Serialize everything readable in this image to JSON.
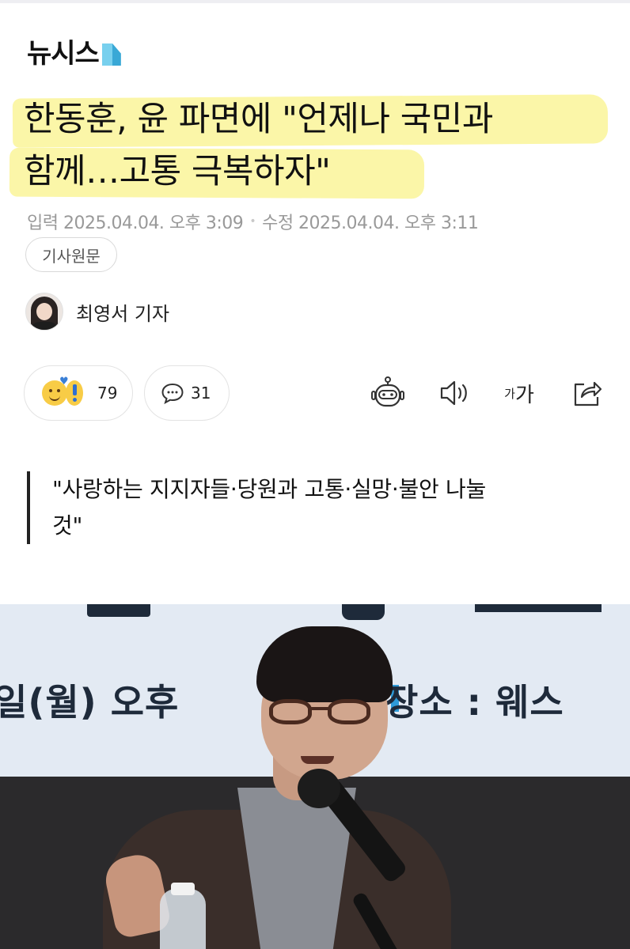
{
  "brand": {
    "logo_text": "뉴시스"
  },
  "article": {
    "title_line1": "한동훈, 윤 파면에 \"언제나 국민과",
    "title_line2": "함께…고통 극복하자\"",
    "published": "입력 2025.04.04. 오후 3:09",
    "modified": "수정 2025.04.04. 오후 3:11",
    "source_button": "기사원문",
    "reporter": "최영서 기자",
    "subtitle_line1": "\"사랑하는 지지자들·당원과 고통·실망·불안 나눌",
    "subtitle_line2": "것\""
  },
  "actions": {
    "reaction_count": "79",
    "comment_count": "31",
    "font_size_small": "가",
    "font_size_large": "가"
  },
  "photo": {
    "banner_left_text": "일(월) 오후",
    "banner_right_text": "장소 : 웨스"
  },
  "colors": {
    "highlight": "#fbf6a8",
    "logo_blue": "#39a8d6"
  },
  "icons": [
    "robot-icon",
    "speaker-icon",
    "font-size-icon",
    "share-icon",
    "reaction-emoji-icon",
    "comment-icon"
  ]
}
